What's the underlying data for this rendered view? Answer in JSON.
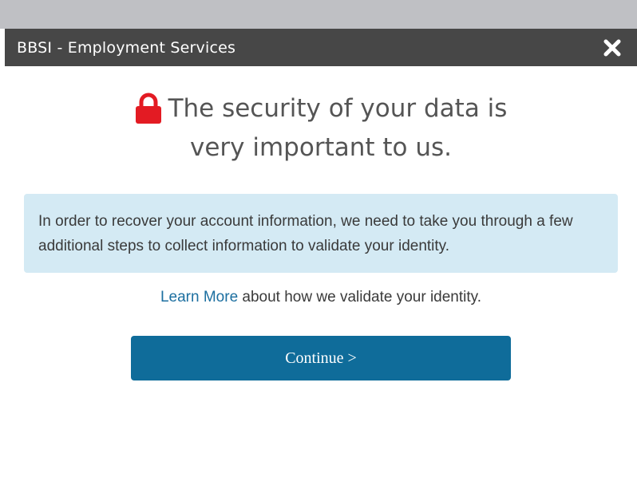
{
  "dialog": {
    "title": "BBSI - Employment Services",
    "close_icon": "close-icon"
  },
  "heading": {
    "line1": "The security of your data is",
    "line2": "very important to us.",
    "icon": "lock-icon",
    "icon_color": "#e31b23"
  },
  "info": {
    "text": "In order to recover your account information, we need to take you through a few additional steps to collect information to validate your identity."
  },
  "learn_more": {
    "link_text": "Learn More",
    "rest_text": " about how we validate your identity."
  },
  "continue_button": {
    "label": "Continue >"
  },
  "colors": {
    "titlebar": "#474747",
    "info_bg": "#d4eaf4",
    "button": "#0f6c9a",
    "link": "#1c6fa0"
  }
}
